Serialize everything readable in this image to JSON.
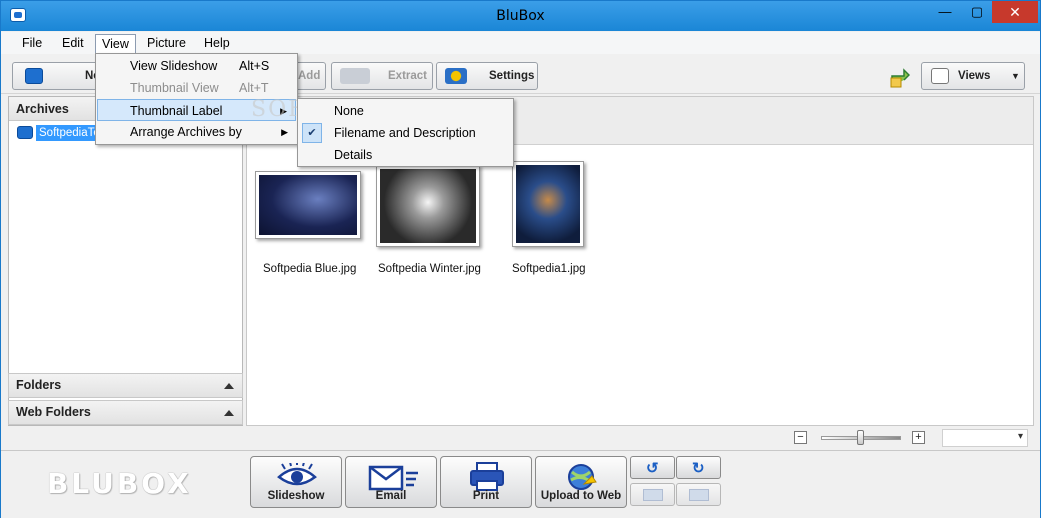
{
  "window": {
    "title": "BluBox",
    "minimize": "—",
    "maximize": "▢",
    "close": "✕"
  },
  "menubar": {
    "items": [
      "File",
      "Edit",
      "View",
      "Picture",
      "Help"
    ]
  },
  "toolbar": {
    "new_label": "New",
    "add_label": "Add",
    "extract_label": "Extract",
    "settings_label": "Settings",
    "views_label": "Views"
  },
  "left_panel": {
    "archives_header": "Archives",
    "archive_item": "SoftpediaTest",
    "folders_header": "Folders",
    "web_folders_header": "Web Folders"
  },
  "thumbnails": [
    {
      "label": "Softpedia Blue.jpg",
      "tint": "#1a2454"
    },
    {
      "label": "Softpedia Winter.jpg",
      "tint": "#3a3a3a"
    },
    {
      "label": "Softpedia1.jpg",
      "tint": "#1e3a6a"
    }
  ],
  "view_menu": {
    "items": [
      {
        "label": "View Slideshow",
        "shortcut": "Alt+S",
        "enabled": true
      },
      {
        "label": "Thumbnail View",
        "shortcut": "Alt+T",
        "enabled": false
      },
      {
        "label": "Thumbnail Label",
        "shortcut": "",
        "enabled": true,
        "submenu": true,
        "highlighted": true
      },
      {
        "label": "Arrange Archives by",
        "shortcut": "",
        "enabled": true,
        "submenu": true
      }
    ]
  },
  "thumbnail_label_submenu": {
    "items": [
      {
        "label": "None",
        "checked": false
      },
      {
        "label": "Filename and Description",
        "checked": true
      },
      {
        "label": "Details",
        "checked": false
      }
    ]
  },
  "statusbar": {
    "zoom_out": "−",
    "zoom_in": "+"
  },
  "bottombar": {
    "logo": "BLUBOX",
    "slideshow_label": "Slideshow",
    "email_label": "Email",
    "print_label": "Print",
    "upload_label": "Upload to Web"
  },
  "colors": {
    "titlebar": "#1a86d6",
    "selection": "#3399ff",
    "close": "#c7392c"
  }
}
